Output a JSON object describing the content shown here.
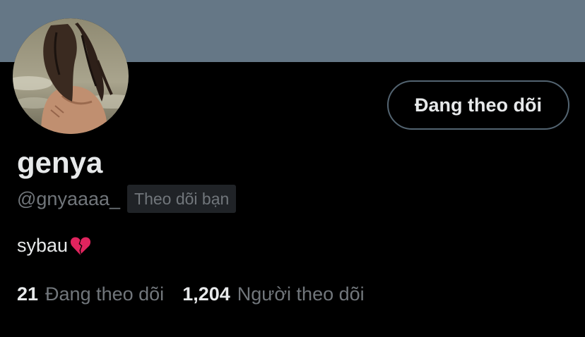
{
  "profile": {
    "display_name": "genya",
    "handle": "@gnyaaaa_",
    "follows_you_badge": "Theo dõi bạn",
    "bio": "sybau",
    "bio_emoji": "broken-heart-icon"
  },
  "actions": {
    "follow_button_label": "Đang theo dõi"
  },
  "stats": {
    "following_count": "21",
    "following_label": "Đang theo dõi",
    "followers_count": "1,204",
    "followers_label": "Người theo dõi"
  },
  "colors": {
    "background": "#000000",
    "banner": "#657786",
    "primary_text": "#e7e9ea",
    "secondary_text": "#71767b",
    "badge_bg": "#202327",
    "button_border": "#536471",
    "emoji_red": "#e0245e"
  }
}
